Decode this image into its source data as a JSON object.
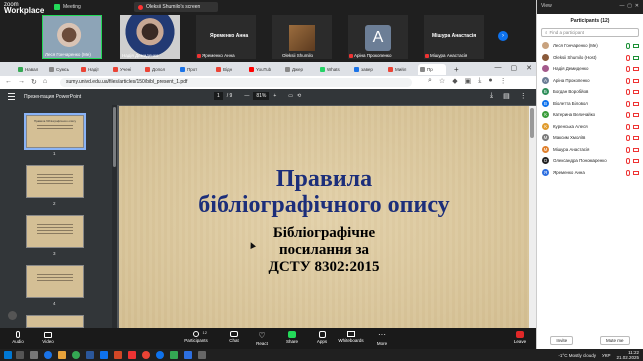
{
  "zoom": {
    "logo_line1": "zoom",
    "logo_line2": "Workplace",
    "meeting_label": "Meeting",
    "share_tab_label": "Oleksii Shumilo's screen",
    "view_label": "View",
    "tiles": [
      {
        "name": "Леся Гончаренко (Ме)"
      },
      {
        "name": "Надія Демиденко"
      },
      {
        "name": "Яременко Анна",
        "display": "Яременко Анна"
      },
      {
        "name": "Oleksii Shumilo"
      },
      {
        "name": "Аріна Прокопенко",
        "letter": "А"
      },
      {
        "name": "Мішура Анастасія",
        "display": "Мішура Анастасія"
      }
    ],
    "toolbar": {
      "audio": "Audio",
      "video": "Video",
      "participants": "Participants",
      "participants_count": "12",
      "chat": "Chat",
      "react": "React",
      "share": "Share",
      "apps": "Apps",
      "whiteboards": "Whiteboards",
      "more": "More",
      "leave": "Leave"
    }
  },
  "participants": {
    "title": "Participants (12)",
    "search_placeholder": "Find a participant",
    "list": [
      {
        "name": "Леся Гончаренко (Me)",
        "color": "#c8a27e",
        "mic_on": true,
        "cam_on": true
      },
      {
        "name": "Oleksii Shumilo (Host)",
        "color": "#8a5a3a",
        "mic_on": false,
        "cam_on": true
      },
      {
        "name": "Надія Демиденко",
        "color": "#a45a8c",
        "mic_on": false,
        "cam_on": false
      },
      {
        "name": "Аріна Прокопенко",
        "color": "#6c7e96",
        "mic_on": false,
        "cam_on": false,
        "letter": "А"
      },
      {
        "name": "Богдан Воробйов",
        "color": "#2f8f5b",
        "mic_on": false,
        "cam_on": false,
        "letter": "Б"
      },
      {
        "name": "Віолетта Біловол",
        "color": "#0e72ed",
        "mic_on": false,
        "cam_on": false,
        "letter": "В"
      },
      {
        "name": "Катерина Величайко",
        "color": "#3a9c3a",
        "mic_on": false,
        "cam_on": false,
        "letter": "К"
      },
      {
        "name": "Куренська Алеся",
        "color": "#e09b2d",
        "mic_on": false,
        "cam_on": false,
        "letter": "К"
      },
      {
        "name": "Максим Хмоліїв",
        "color": "#7b7b7b",
        "mic_on": false,
        "cam_on": false,
        "letter": "М"
      },
      {
        "name": "Мішура Анастасія",
        "color": "#e0802d",
        "mic_on": false,
        "cam_on": false,
        "letter": "М"
      },
      {
        "name": "Олександра Пономаренко",
        "color": "#222222",
        "mic_on": false,
        "cam_on": false,
        "letter": "О"
      },
      {
        "name": "Яременко Анна",
        "color": "#2d6fe0",
        "mic_on": false,
        "cam_on": false,
        "letter": "Я"
      }
    ],
    "invite": "Invite",
    "mute_me": "Mute me"
  },
  "browser": {
    "tabs": [
      {
        "label": "Навал",
        "color": "#34a853"
      },
      {
        "label": "Сумсь",
        "color": "#888"
      },
      {
        "label": "Надії",
        "color": "#ea4335"
      },
      {
        "label": "Учені",
        "color": "#ea4335"
      },
      {
        "label": "Допол",
        "color": "#ea4335"
      },
      {
        "label": "Прот",
        "color": "#1a73e8"
      },
      {
        "label": "Відн",
        "color": "#ea4335"
      },
      {
        "label": "YouTub",
        "color": "#ff0000"
      },
      {
        "label": "Джер",
        "color": "#888"
      },
      {
        "label": "Whats",
        "color": "#25d366"
      },
      {
        "label": "завер",
        "color": "#1a73e8"
      },
      {
        "label": "Мийл",
        "color": "#ea4335"
      },
      {
        "label": "Пр",
        "color": "#888",
        "active": true
      }
    ],
    "url": "sumy.univd.edu.ua/files/articles/150/bibl_present_1.pdf",
    "pdf_title": "Презентация PowerPoint",
    "page_current": "1",
    "page_total": "/ 9",
    "zoom_level": "81%",
    "thumb_numbers": [
      "1",
      "2",
      "3",
      "4"
    ],
    "thumb1_title": "Правила бібліографічного опису"
  },
  "slide": {
    "title_line1": "Правила",
    "title_line2": "бібліографічного опису",
    "sub_line1": "Бібліографічне",
    "sub_line2": "посилання за",
    "sub_line3": "ДСТУ 8302:2015"
  },
  "taskbar": {
    "weather": "-1°C  Mostly cloudy",
    "time": "11:22",
    "date": "21.02.2025",
    "lang": "УКР"
  }
}
